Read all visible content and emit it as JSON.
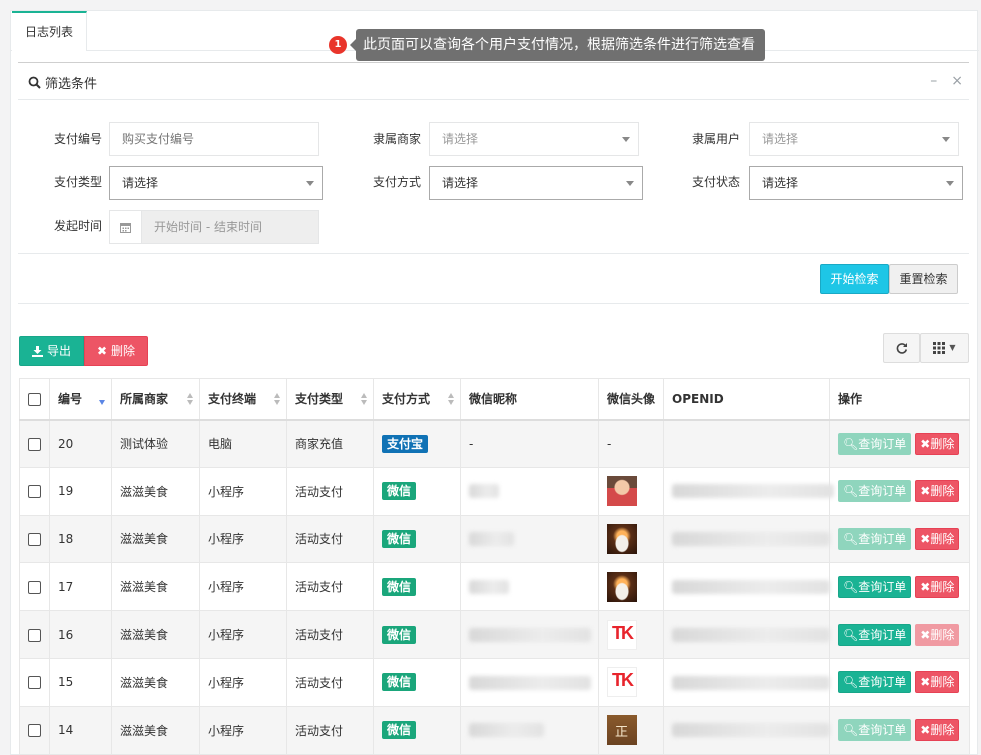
{
  "tabs": [
    {
      "label": "日志列表"
    }
  ],
  "hint": {
    "number": "1",
    "text": "此页面可以查询各个用户支付情况，根据筛选条件进行筛选查看"
  },
  "filter": {
    "title": "筛选条件",
    "fields": {
      "pay_no": {
        "label": "支付编号",
        "placeholder": "购买支付编号"
      },
      "merchant": {
        "label": "隶属商家",
        "value": "请选择"
      },
      "user": {
        "label": "隶属用户",
        "value": "请选择"
      },
      "pay_type": {
        "label": "支付类型",
        "value": "请选择"
      },
      "pay_method": {
        "label": "支付方式",
        "value": "请选择"
      },
      "pay_status": {
        "label": "支付状态",
        "value": "请选择"
      },
      "start_time": {
        "label": "发起时间",
        "placeholder": "开始时间 - 结束时间"
      }
    },
    "search_label": "开始检索",
    "reset_label": "重置检索"
  },
  "toolbar": {
    "export_label": "导出",
    "delete_label": "删除"
  },
  "table": {
    "columns": [
      "编号",
      "所属商家",
      "支付终端",
      "支付类型",
      "支付方式",
      "微信昵称",
      "微信头像",
      "OPENID",
      "操作"
    ],
    "query_label": "查询订单",
    "delete_label": "删除",
    "rows": [
      {
        "id": "20",
        "merchant": "测试体验",
        "terminal": "电脑",
        "type": "商家充值",
        "method": "支付宝",
        "nickname": "-",
        "avatar": "-"
      },
      {
        "id": "19",
        "merchant": "滋滋美食",
        "terminal": "小程序",
        "type": "活动支付",
        "method": "微信",
        "nickname": "",
        "avatar": ""
      },
      {
        "id": "18",
        "merchant": "滋滋美食",
        "terminal": "小程序",
        "type": "活动支付",
        "method": "微信",
        "nickname": "",
        "avatar": ""
      },
      {
        "id": "17",
        "merchant": "滋滋美食",
        "terminal": "小程序",
        "type": "活动支付",
        "method": "微信",
        "nickname": "",
        "avatar": ""
      },
      {
        "id": "16",
        "merchant": "滋滋美食",
        "terminal": "小程序",
        "type": "活动支付",
        "method": "微信",
        "nickname": "",
        "avatar": ""
      },
      {
        "id": "15",
        "merchant": "滋滋美食",
        "terminal": "小程序",
        "type": "活动支付",
        "method": "微信",
        "nickname": "",
        "avatar": ""
      },
      {
        "id": "14",
        "merchant": "滋滋美食",
        "terminal": "小程序",
        "type": "活动支付",
        "method": "微信",
        "nickname": "",
        "avatar": ""
      }
    ]
  }
}
